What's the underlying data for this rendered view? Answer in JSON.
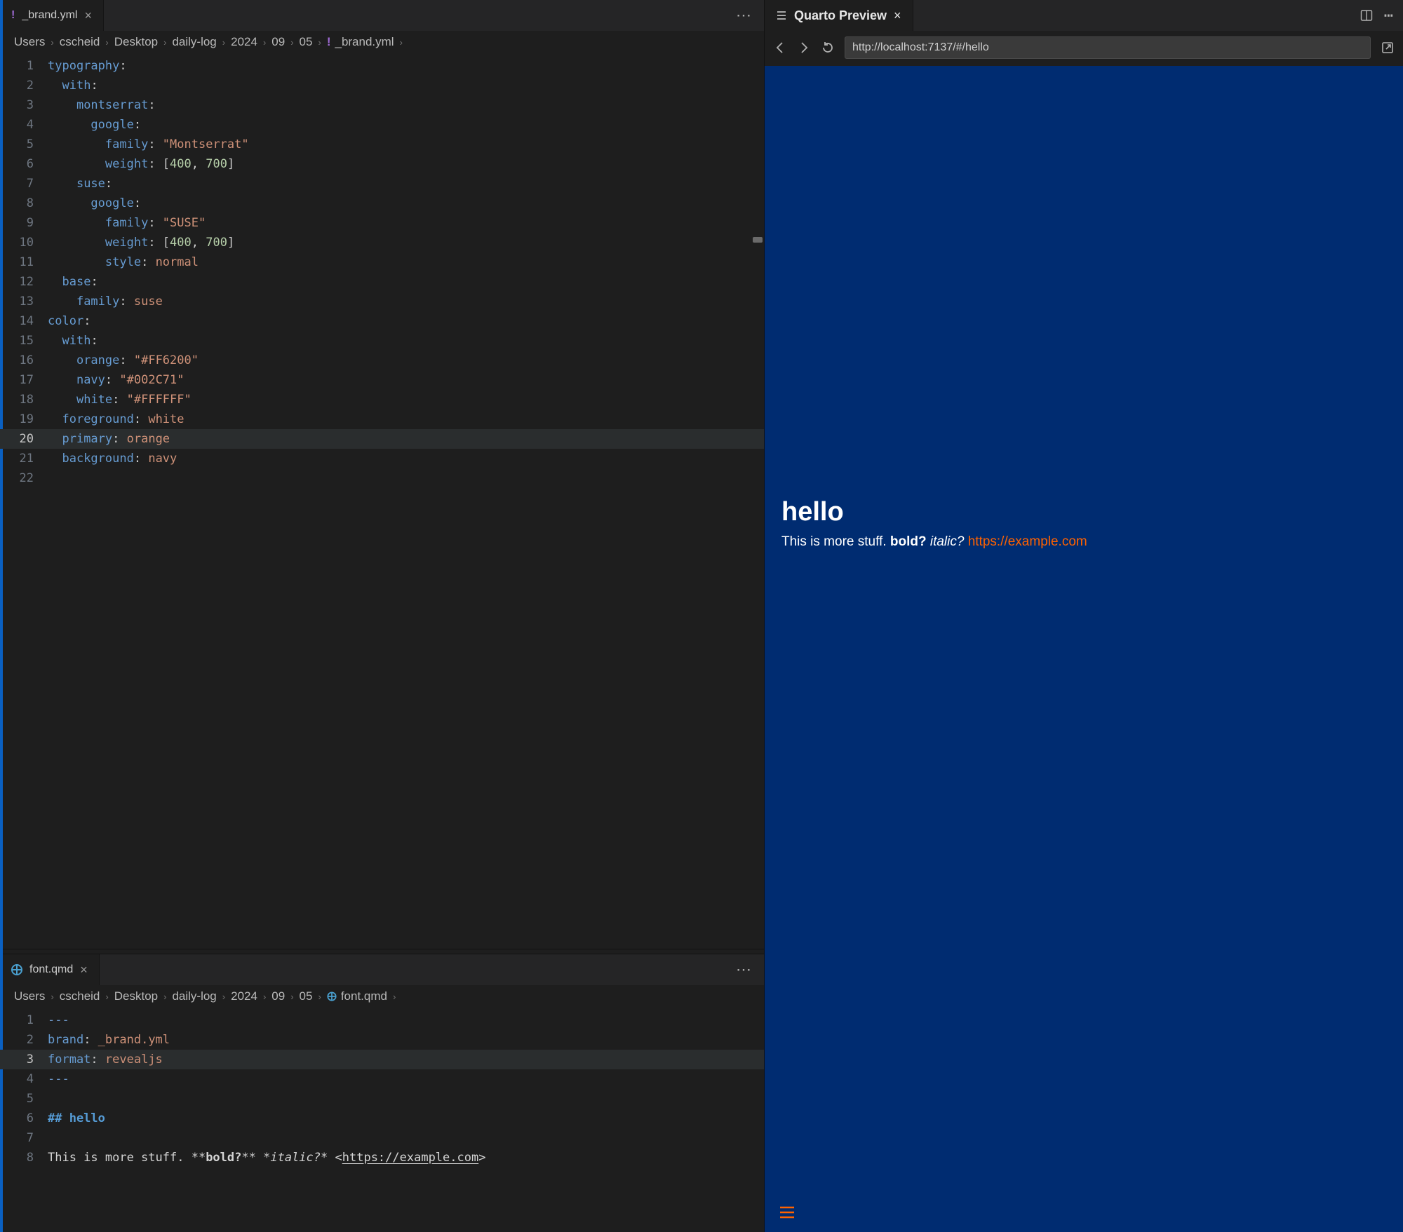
{
  "editor1": {
    "tab": {
      "icon": "!",
      "iconColor": "#a06bd6",
      "label": "_brand.yml"
    },
    "breadcrumbs": [
      "Users",
      "cscheid",
      "Desktop",
      "daily-log",
      "2024",
      "09",
      "05"
    ],
    "breadcrumbFile": {
      "icon": "!",
      "iconColor": "#a06bd6",
      "label": "_brand.yml"
    },
    "currentLine": 20,
    "lines": [
      {
        "n": 1,
        "indent": 0,
        "t": [
          [
            "key",
            "typography"
          ],
          [
            "punc",
            ":"
          ]
        ]
      },
      {
        "n": 2,
        "indent": 1,
        "t": [
          [
            "key",
            "with"
          ],
          [
            "punc",
            ":"
          ]
        ]
      },
      {
        "n": 3,
        "indent": 2,
        "t": [
          [
            "key",
            "montserrat"
          ],
          [
            "punc",
            ":"
          ]
        ]
      },
      {
        "n": 4,
        "indent": 3,
        "t": [
          [
            "key",
            "google"
          ],
          [
            "punc",
            ":"
          ]
        ]
      },
      {
        "n": 5,
        "indent": 4,
        "t": [
          [
            "key",
            "family"
          ],
          [
            "punc",
            ": "
          ],
          [
            "str",
            "\"Montserrat\""
          ]
        ]
      },
      {
        "n": 6,
        "indent": 4,
        "t": [
          [
            "key",
            "weight"
          ],
          [
            "punc",
            ": ["
          ],
          [
            "num",
            "400"
          ],
          [
            "punc",
            ", "
          ],
          [
            "num",
            "700"
          ],
          [
            "punc",
            "]"
          ]
        ]
      },
      {
        "n": 7,
        "indent": 2,
        "t": [
          [
            "key",
            "suse"
          ],
          [
            "punc",
            ":"
          ]
        ]
      },
      {
        "n": 8,
        "indent": 3,
        "t": [
          [
            "key",
            "google"
          ],
          [
            "punc",
            ":"
          ]
        ]
      },
      {
        "n": 9,
        "indent": 4,
        "t": [
          [
            "key",
            "family"
          ],
          [
            "punc",
            ": "
          ],
          [
            "str",
            "\"SUSE\""
          ]
        ]
      },
      {
        "n": 10,
        "indent": 4,
        "t": [
          [
            "key",
            "weight"
          ],
          [
            "punc",
            ": ["
          ],
          [
            "num",
            "400"
          ],
          [
            "punc",
            ", "
          ],
          [
            "num",
            "700"
          ],
          [
            "punc",
            "]"
          ]
        ]
      },
      {
        "n": 11,
        "indent": 4,
        "t": [
          [
            "key",
            "style"
          ],
          [
            "punc",
            ": "
          ],
          [
            "str",
            "normal"
          ]
        ]
      },
      {
        "n": 12,
        "indent": 1,
        "t": [
          [
            "key",
            "base"
          ],
          [
            "punc",
            ":"
          ]
        ]
      },
      {
        "n": 13,
        "indent": 2,
        "t": [
          [
            "key",
            "family"
          ],
          [
            "punc",
            ": "
          ],
          [
            "str",
            "suse"
          ]
        ]
      },
      {
        "n": 14,
        "indent": 0,
        "t": [
          [
            "key",
            "color"
          ],
          [
            "punc",
            ":"
          ]
        ]
      },
      {
        "n": 15,
        "indent": 1,
        "t": [
          [
            "key",
            "with"
          ],
          [
            "punc",
            ":"
          ]
        ]
      },
      {
        "n": 16,
        "indent": 2,
        "t": [
          [
            "key",
            "orange"
          ],
          [
            "punc",
            ": "
          ],
          [
            "str",
            "\"#FF6200\""
          ]
        ]
      },
      {
        "n": 17,
        "indent": 2,
        "t": [
          [
            "key",
            "navy"
          ],
          [
            "punc",
            ": "
          ],
          [
            "str",
            "\"#002C71\""
          ]
        ]
      },
      {
        "n": 18,
        "indent": 2,
        "t": [
          [
            "key",
            "white"
          ],
          [
            "punc",
            ": "
          ],
          [
            "str",
            "\"#FFFFFF\""
          ]
        ]
      },
      {
        "n": 19,
        "indent": 1,
        "t": [
          [
            "key",
            "foreground"
          ],
          [
            "punc",
            ": "
          ],
          [
            "str",
            "white"
          ]
        ]
      },
      {
        "n": 20,
        "indent": 1,
        "t": [
          [
            "key",
            "primary"
          ],
          [
            "punc",
            ": "
          ],
          [
            "str",
            "orange"
          ]
        ]
      },
      {
        "n": 21,
        "indent": 1,
        "t": [
          [
            "key",
            "background"
          ],
          [
            "punc",
            ": "
          ],
          [
            "str",
            "navy"
          ]
        ]
      },
      {
        "n": 22,
        "indent": 0,
        "t": []
      }
    ]
  },
  "editor2": {
    "tab": {
      "iconColor": "#4aa0d0",
      "label": "font.qmd"
    },
    "breadcrumbs": [
      "Users",
      "cscheid",
      "Desktop",
      "daily-log",
      "2024",
      "09",
      "05"
    ],
    "breadcrumbFile": {
      "iconColor": "#4aa0d0",
      "label": "font.qmd"
    },
    "currentLine": 3,
    "lines": [
      {
        "n": 1,
        "indent": 0,
        "t": [
          [
            "fm",
            "---"
          ]
        ]
      },
      {
        "n": 2,
        "indent": 0,
        "t": [
          [
            "key",
            "brand"
          ],
          [
            "punc",
            ": "
          ],
          [
            "str",
            "_brand.yml"
          ]
        ]
      },
      {
        "n": 3,
        "indent": 0,
        "t": [
          [
            "key",
            "format"
          ],
          [
            "punc",
            ": "
          ],
          [
            "str",
            "revealjs"
          ]
        ]
      },
      {
        "n": 4,
        "indent": 0,
        "t": [
          [
            "fm",
            "---"
          ]
        ]
      },
      {
        "n": 5,
        "indent": 0,
        "t": []
      },
      {
        "n": 6,
        "indent": 0,
        "t": [
          [
            "head",
            "## hello"
          ]
        ]
      },
      {
        "n": 7,
        "indent": 0,
        "t": []
      },
      {
        "n": 8,
        "indent": 0,
        "t": [
          [
            "plain",
            "This is more stuff. "
          ],
          [
            "mk",
            "**"
          ],
          [
            "bold",
            "bold?"
          ],
          [
            "mk",
            "**"
          ],
          [
            "plain",
            " "
          ],
          [
            "mk",
            "*"
          ],
          [
            "ital",
            "italic?"
          ],
          [
            "mk",
            "*"
          ],
          [
            "plain",
            " <"
          ],
          [
            "link",
            "https://example.com"
          ],
          [
            "plain",
            ">"
          ]
        ]
      }
    ]
  },
  "preview": {
    "tabLabel": "Quarto Preview",
    "url": "http://localhost:7137/#/hello",
    "heading": "hello",
    "body": {
      "t1": "This is more stuff. ",
      "bold": "bold?",
      "space": " ",
      "italic": "italic?",
      "space2": " ",
      "link": "https://example.com"
    },
    "colors": {
      "bg": "#002C71",
      "accent": "#FF6200",
      "fg": "#FFFFFF"
    }
  }
}
